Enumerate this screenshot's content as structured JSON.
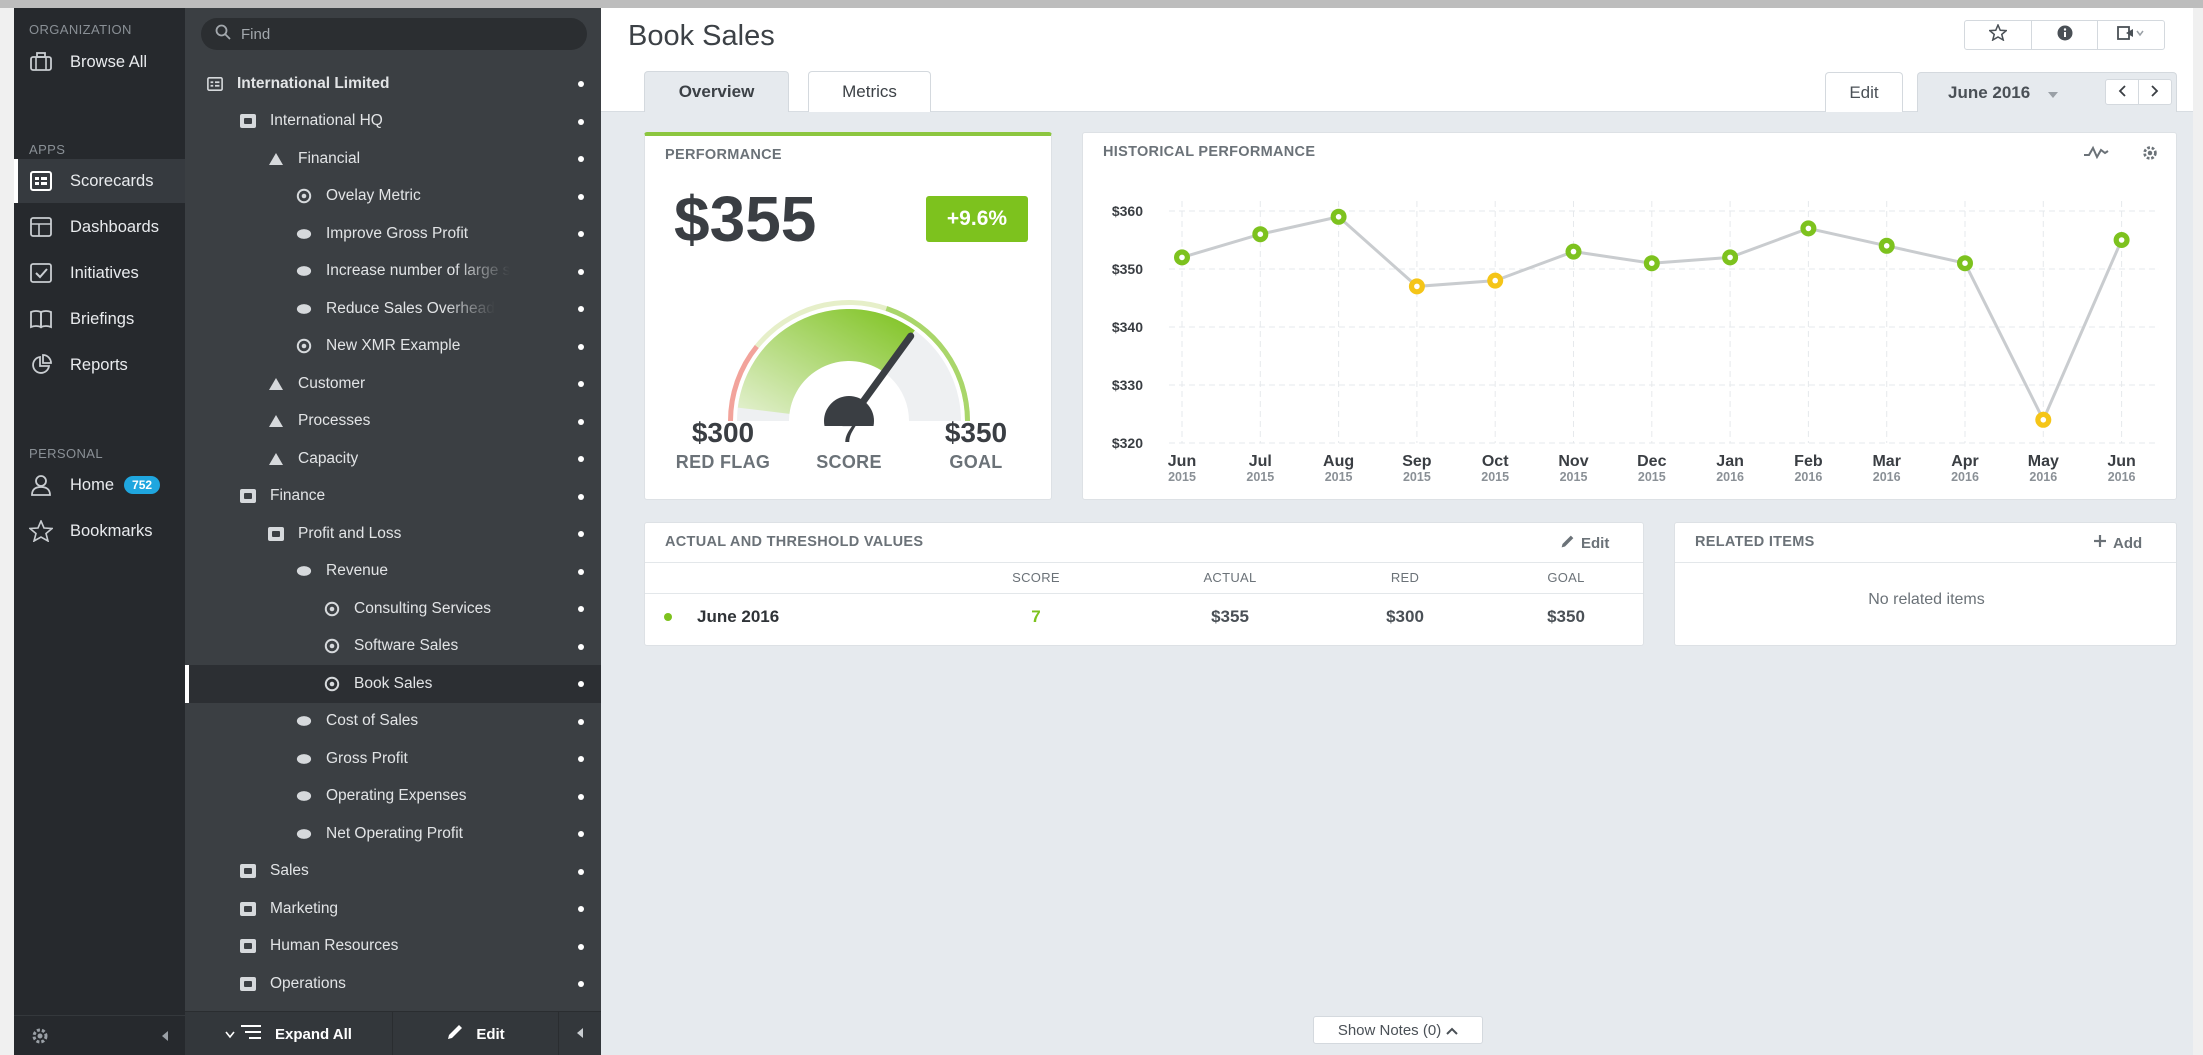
{
  "nav": {
    "sections": {
      "organization": "ORGANIZATION",
      "apps": "APPS",
      "personal": "PERSONAL"
    },
    "items": [
      {
        "label": "Browse All",
        "icon": "briefcase-icon"
      },
      {
        "label": "Scorecards",
        "icon": "scorecard-icon"
      },
      {
        "label": "Dashboards",
        "icon": "dashboard-icon"
      },
      {
        "label": "Initiatives",
        "icon": "checkbox-icon"
      },
      {
        "label": "Briefings",
        "icon": "book-icon"
      },
      {
        "label": "Reports",
        "icon": "pie-icon"
      },
      {
        "label": "Home",
        "icon": "user-icon",
        "badge": "752"
      },
      {
        "label": "Bookmarks",
        "icon": "star-icon"
      }
    ]
  },
  "tree": {
    "search_placeholder": "Find",
    "nodes": [
      {
        "label": "International Limited",
        "level": 0,
        "icon": "org-icon"
      },
      {
        "label": "International HQ",
        "level": 1,
        "icon": "scorecard-icon"
      },
      {
        "label": "Financial",
        "level": 2,
        "icon": "triangle-icon"
      },
      {
        "label": "Ovelay Metric",
        "level": 3,
        "icon": "eye-icon"
      },
      {
        "label": "Improve Gross Profit",
        "level": 3,
        "icon": "ellipse-icon"
      },
      {
        "label": "Increase number of large s",
        "level": 3,
        "icon": "ellipse-icon"
      },
      {
        "label": "Reduce Sales Overhead",
        "level": 3,
        "icon": "ellipse-icon"
      },
      {
        "label": "New XMR Example",
        "level": 3,
        "icon": "eye-icon"
      },
      {
        "label": "Customer",
        "level": 2,
        "icon": "triangle-icon"
      },
      {
        "label": "Processes",
        "level": 2,
        "icon": "triangle-icon"
      },
      {
        "label": "Capacity",
        "level": 2,
        "icon": "triangle-icon"
      },
      {
        "label": "Finance",
        "level": 1,
        "icon": "scorecard-icon"
      },
      {
        "label": "Profit and Loss",
        "level": 2,
        "icon": "scorecard-icon"
      },
      {
        "label": "Revenue",
        "level": 3,
        "icon": "ellipse-icon"
      },
      {
        "label": "Consulting Services",
        "level": 4,
        "icon": "eye-icon"
      },
      {
        "label": "Software Sales",
        "level": 4,
        "icon": "eye-icon"
      },
      {
        "label": "Book Sales",
        "level": 4,
        "icon": "eye-icon",
        "selected": true
      },
      {
        "label": "Cost of Sales",
        "level": 3,
        "icon": "ellipse-icon"
      },
      {
        "label": "Gross Profit",
        "level": 3,
        "icon": "ellipse-icon"
      },
      {
        "label": "Operating Expenses",
        "level": 3,
        "icon": "ellipse-icon"
      },
      {
        "label": "Net Operating Profit",
        "level": 3,
        "icon": "ellipse-icon"
      },
      {
        "label": "Sales",
        "level": 1,
        "icon": "scorecard-icon"
      },
      {
        "label": "Marketing",
        "level": 1,
        "icon": "scorecard-icon"
      },
      {
        "label": "Human Resources",
        "level": 1,
        "icon": "scorecard-icon"
      },
      {
        "label": "Operations",
        "level": 1,
        "icon": "scorecard-icon"
      }
    ],
    "footer": {
      "expand_label": "Expand All",
      "edit_label": "Edit"
    }
  },
  "main": {
    "title": "Book Sales",
    "tabs": [
      "Overview",
      "Metrics"
    ],
    "edit_label": "Edit",
    "period": "June 2016",
    "performance": {
      "title": "PERFORMANCE",
      "value": "$355",
      "change": "+9.6%",
      "score": 7,
      "score_max": 10,
      "red_flag": "$300",
      "red_flag_label": "RED FLAG",
      "score_label": "SCORE",
      "goal": "$350",
      "goal_label": "GOAL"
    },
    "historical": {
      "title": "HISTORICAL PERFORMANCE"
    },
    "actuals": {
      "title": "ACTUAL AND THRESHOLD VALUES",
      "edit_label": "Edit",
      "headers": [
        "SCORE",
        "ACTUAL",
        "RED",
        "GOAL"
      ],
      "row": {
        "period": "June 2016",
        "score": "7",
        "actual": "$355",
        "red": "$300",
        "goal": "$350"
      }
    },
    "related": {
      "title": "RELATED ITEMS",
      "add_label": "Add",
      "empty": "No related items"
    },
    "notes_label": "Show Notes (0)"
  },
  "colors": {
    "green": "#7dc21e",
    "yellow": "#f5c518",
    "red": "#f2a39b"
  },
  "chart_data": {
    "type": "line",
    "categories": [
      "Jun 2015",
      "Jul 2015",
      "Aug 2015",
      "Sep 2015",
      "Oct 2015",
      "Nov 2015",
      "Dec 2015",
      "Jan 2016",
      "Feb 2016",
      "Mar 2016",
      "Apr 2016",
      "May 2016",
      "Jun 2016"
    ],
    "x_months": [
      "Jun",
      "Jul",
      "Aug",
      "Sep",
      "Oct",
      "Nov",
      "Dec",
      "Jan",
      "Feb",
      "Mar",
      "Apr",
      "May",
      "Jun"
    ],
    "x_years": [
      "2015",
      "2015",
      "2015",
      "2015",
      "2015",
      "2015",
      "2015",
      "2016",
      "2016",
      "2016",
      "2016",
      "2016",
      "2016"
    ],
    "values": [
      352,
      356,
      359,
      347,
      348,
      353,
      351,
      352,
      357,
      354,
      351,
      324,
      355
    ],
    "status": [
      "green",
      "green",
      "green",
      "yellow",
      "yellow",
      "green",
      "green",
      "green",
      "green",
      "green",
      "green",
      "yellow",
      "green"
    ],
    "yticks": [
      "$360",
      "$350",
      "$340",
      "$330",
      "$320"
    ],
    "ylim": [
      320,
      360
    ],
    "grid": true
  }
}
